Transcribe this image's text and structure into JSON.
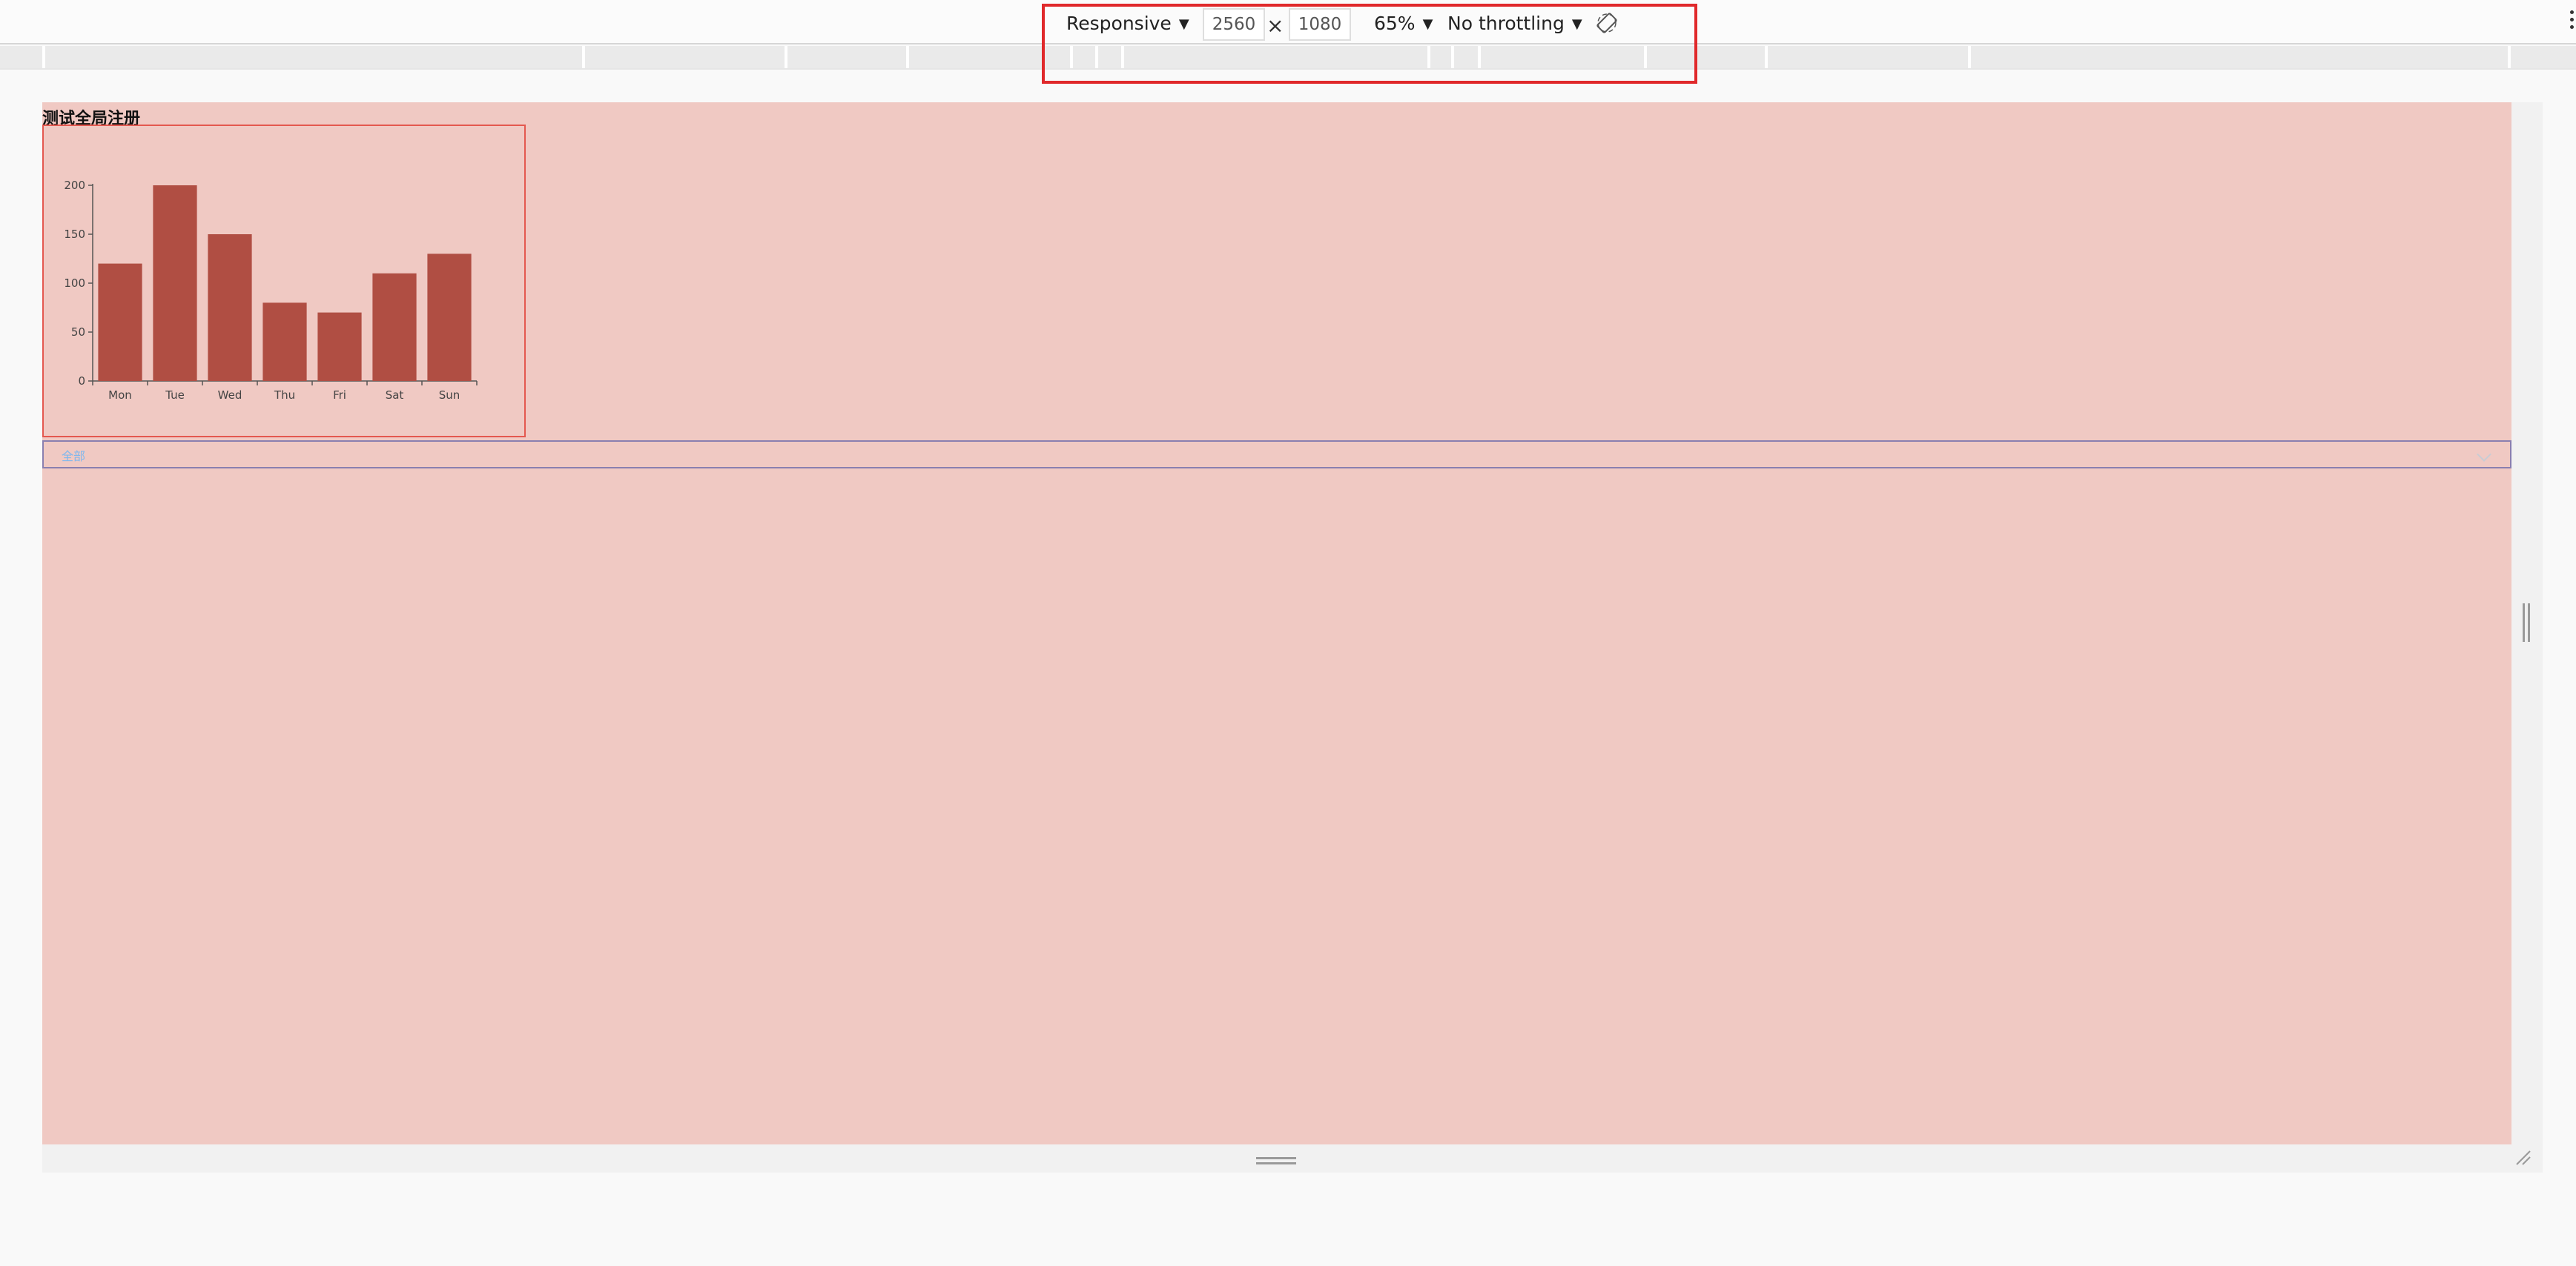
{
  "devtools": {
    "device_mode": "Responsive",
    "width_value": "2560",
    "height_value": "1080",
    "dimension_separator": "×",
    "zoom": "65%",
    "throttling": "No throttling",
    "dropdown_caret": "▼",
    "rotate_icon": "rotate-icon",
    "highlight_color": "#e0292b"
  },
  "page": {
    "title": "测试全局注册",
    "select": {
      "value": "全部"
    }
  },
  "colors": {
    "viewport_bg": "#f0c9c3",
    "bar": "#b04e43",
    "chart_border": "#e4584f"
  },
  "chart_data": {
    "type": "bar",
    "categories": [
      "Mon",
      "Tue",
      "Wed",
      "Thu",
      "Fri",
      "Sat",
      "Sun"
    ],
    "values": [
      120,
      200,
      150,
      80,
      70,
      110,
      130
    ],
    "ylim": [
      0,
      200
    ],
    "yticks": [
      0,
      50,
      100,
      150,
      200
    ],
    "grid": false,
    "title": "",
    "xlabel": "",
    "ylabel": ""
  }
}
